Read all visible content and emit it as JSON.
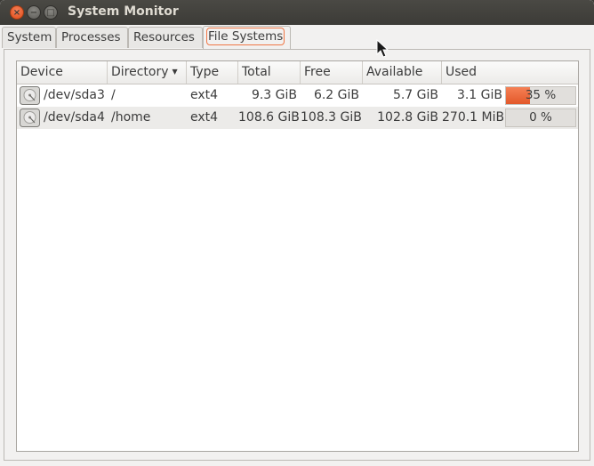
{
  "window": {
    "title": "System Monitor",
    "buttons": {
      "close": "×",
      "minimize": "−",
      "maximize": "□"
    }
  },
  "tabs": [
    {
      "label": "System",
      "active": false
    },
    {
      "label": "Processes",
      "active": false
    },
    {
      "label": "Resources",
      "active": false
    },
    {
      "label": "File Systems",
      "active": true
    }
  ],
  "table": {
    "columns": [
      "Device",
      "Directory",
      "Type",
      "Total",
      "Free",
      "Available",
      "Used"
    ],
    "sort_column": "Directory",
    "rows": [
      {
        "device": "/dev/sda3",
        "directory": "/",
        "type": "ext4",
        "total": "9.3 GiB",
        "free": "6.2 GiB",
        "available": "5.7 GiB",
        "used": "3.1 GiB",
        "percent_label": "35 %",
        "percent": 35
      },
      {
        "device": "/dev/sda4",
        "directory": "/home",
        "type": "ext4",
        "total": "108.6 GiB",
        "free": "108.3 GiB",
        "available": "102.8 GiB",
        "used": "270.1 MiB",
        "percent_label": "0 %",
        "percent": 0
      }
    ]
  },
  "icons": {
    "device": "hard-disk-icon",
    "sort": "sort-descending-icon",
    "cursor": "mouse-pointer-icon"
  },
  "colors": {
    "accent": "#f07746",
    "titlebar": "#3c3b37",
    "usage_fill": "#e3592a"
  }
}
